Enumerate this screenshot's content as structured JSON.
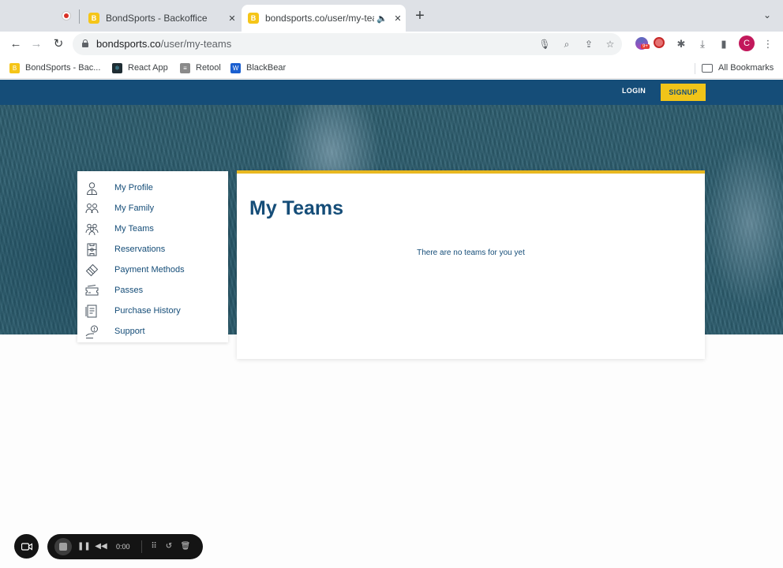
{
  "browser": {
    "tabs": [
      {
        "title": "BondSports - Backoffice",
        "active": false
      },
      {
        "title": "bondsports.co/user/my-teams",
        "active": true
      }
    ],
    "new_tab": "+",
    "url_domain": "bondsports.co",
    "url_path": "/user/my-teams",
    "profile_initial": "C",
    "bookmarks": [
      {
        "label": "BondSports - Bac...",
        "icon": "bondsports-icon"
      },
      {
        "label": "React App",
        "icon": "react-icon"
      },
      {
        "label": "Retool",
        "icon": "retool-icon"
      },
      {
        "label": "BlackBear",
        "icon": "blackbear-icon"
      }
    ],
    "all_bookmarks": "All Bookmarks"
  },
  "header": {
    "login": "LOGIN",
    "signup": "SIGNUP",
    "colors": {
      "primary": "#154d78",
      "accent": "#f0c419"
    }
  },
  "sidebar": {
    "items": [
      {
        "label": "My Profile",
        "icon": "profile-icon"
      },
      {
        "label": "My Family",
        "icon": "family-icon"
      },
      {
        "label": "My Teams",
        "icon": "teams-icon"
      },
      {
        "label": "Reservations",
        "icon": "reservations-icon"
      },
      {
        "label": "Payment Methods",
        "icon": "payment-icon"
      },
      {
        "label": "Passes",
        "icon": "passes-icon"
      },
      {
        "label": "Purchase History",
        "icon": "purchase-history-icon"
      },
      {
        "label": "Support",
        "icon": "support-icon"
      }
    ]
  },
  "main": {
    "title": "My Teams",
    "empty_message": "There are no teams for you yet"
  },
  "recorder": {
    "time": "0:00"
  }
}
